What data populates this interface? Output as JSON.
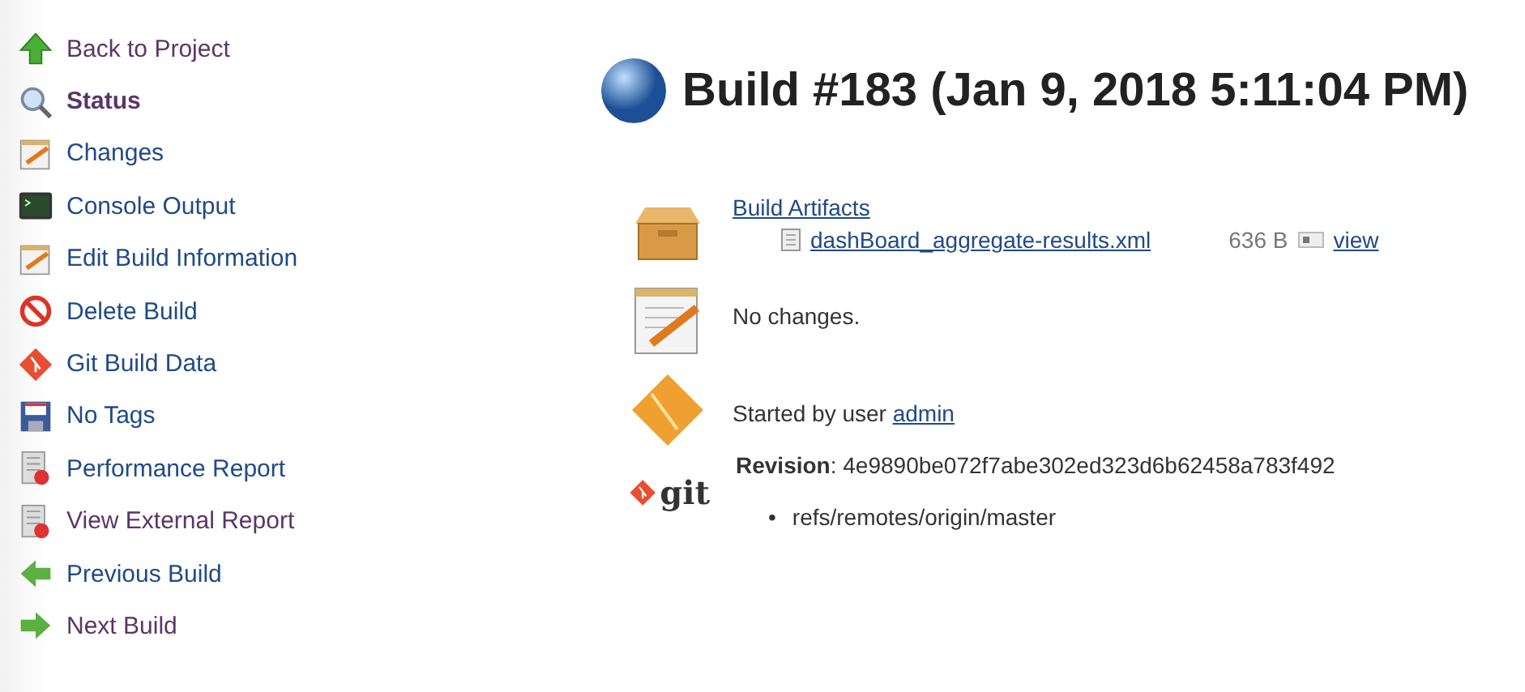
{
  "sidebar": {
    "items": [
      {
        "label": "Back to Project",
        "kind": "up-arrow",
        "selected": false,
        "visited": true
      },
      {
        "label": "Status",
        "kind": "magnifier",
        "selected": true,
        "visited": true
      },
      {
        "label": "Changes",
        "kind": "notepad",
        "selected": false,
        "visited": false
      },
      {
        "label": "Console Output",
        "kind": "terminal",
        "selected": false,
        "visited": false
      },
      {
        "label": "Edit Build Information",
        "kind": "notepad",
        "selected": false,
        "visited": false
      },
      {
        "label": "Delete Build",
        "kind": "prohibited",
        "selected": false,
        "visited": false
      },
      {
        "label": "Git Build Data",
        "kind": "git",
        "selected": false,
        "visited": false
      },
      {
        "label": "No Tags",
        "kind": "floppy",
        "selected": false,
        "visited": false
      },
      {
        "label": "Performance Report",
        "kind": "report",
        "selected": false,
        "visited": false
      },
      {
        "label": "View External Report",
        "kind": "report",
        "selected": false,
        "visited": true
      },
      {
        "label": "Previous Build",
        "kind": "left-arrow",
        "selected": false,
        "visited": false
      },
      {
        "label": "Next Build",
        "kind": "right-arrow",
        "selected": false,
        "visited": true
      }
    ]
  },
  "title": "Build #183 (Jan 9, 2018 5:11:04 PM)",
  "artifacts": {
    "heading": "Build Artifacts",
    "files": [
      {
        "name": "dashBoard_aggregate-results.xml",
        "size": "636 B",
        "action": "view"
      }
    ]
  },
  "changes": "No changes.",
  "started_by": {
    "text": "Started by user",
    "user": "admin"
  },
  "git": {
    "logo_text": "git",
    "revision": "**Revision**: 4e9890be072f7abe302ed323d6b62458a783f492",
    "branches": [
      {
        "marker": "•",
        "name": "refs/remotes/origin/master"
      }
    ]
  }
}
